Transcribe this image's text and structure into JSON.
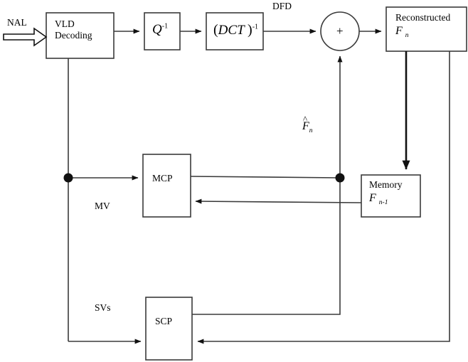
{
  "diagram": {
    "title": "Video decoder block diagram",
    "background_color": "#ffffff",
    "line_color": "#3a3a3a",
    "text_color": "#000000",
    "nodes": {
      "vld": {
        "line1": "VLD",
        "line2": "Decoding"
      },
      "iq": {
        "symbol": "Q",
        "exponent": "-1"
      },
      "idct": {
        "open_paren": "(",
        "symbol": "DCT",
        "close_paren": ")",
        "exponent": "-1"
      },
      "adder": {
        "operator": "+"
      },
      "reconstructed": {
        "line1": "Reconstructed",
        "symbol": "F",
        "subscript": "n"
      },
      "memory": {
        "line1": "Memory",
        "symbol": "F",
        "subscript": "n-1"
      },
      "mcp": {
        "label": "MCP"
      },
      "scp": {
        "label": "SCP"
      }
    },
    "edge_labels": {
      "input": "NAL",
      "dfd": "DFD",
      "prediction": {
        "hat": "^",
        "symbol": "F",
        "subscript": "n"
      },
      "motion_vectors": "MV",
      "spatial_vectors": "SVs"
    }
  }
}
